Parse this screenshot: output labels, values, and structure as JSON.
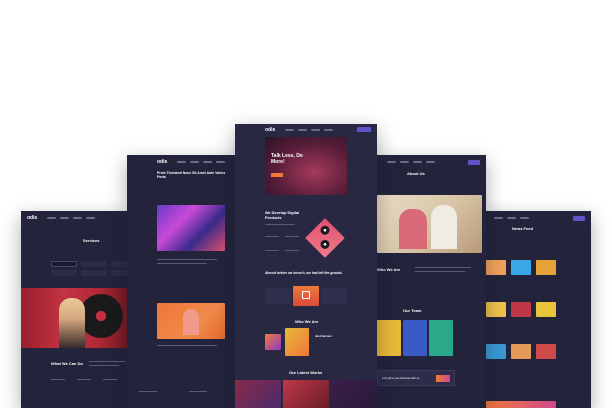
{
  "brand": "odis",
  "pages": {
    "services": {
      "title": "Services",
      "section": "What We Can Do"
    },
    "blog": {
      "headline": "Proin Tincidunt Nunc Sit Amet Ante Varius Porta"
    },
    "home": {
      "hero": "Talk Less, Do More!",
      "products": "We Develop Digital Products",
      "about_line": "Almost before we knew it, we had left the ground.",
      "who": "Who We Are",
      "works": "Our Latest Works",
      "tag": "Just Harvest"
    },
    "about": {
      "title": "About Us",
      "who": "Who We Are",
      "team": "Our Team",
      "cta": "Let's grow your business with us"
    },
    "news": {
      "title": "News Feed"
    }
  },
  "colors": {
    "bg": "#23233c",
    "accent": "#5d55c8",
    "orange": "#f07a3c",
    "pink": "#e0506e"
  }
}
